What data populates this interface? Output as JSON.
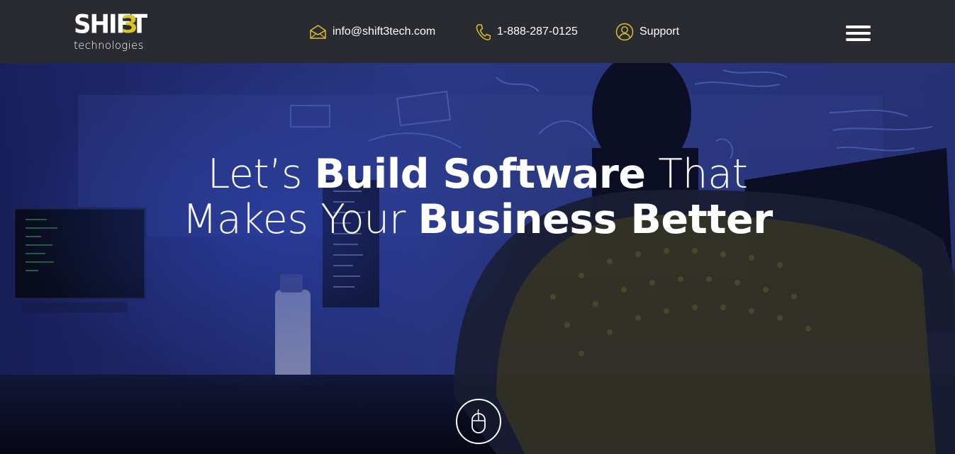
{
  "header": {
    "logo": {
      "word": "SHIFT",
      "number": "3",
      "sub": "technologies"
    },
    "email": {
      "icon": "envelope-icon",
      "label": "info@shift3tech.com"
    },
    "phone": {
      "icon": "phone-icon",
      "label": "1-888-287-0125"
    },
    "support": {
      "icon": "user-circle-icon",
      "label": "Support"
    },
    "menu_icon": "hamburger-menu-icon"
  },
  "hero": {
    "headline": {
      "line1_thin_a": "Let’s ",
      "line1_bold": "Build Software",
      "line1_thin_b": " That",
      "line2_thin": "Makes Your ",
      "line2_bold": "Business Better"
    },
    "scroll_icon": "mouse-scroll-icon"
  },
  "colors": {
    "topbar": "#2a2b30",
    "accent": "#d9c327",
    "hero_dark": "#0a0d24",
    "hero_blue": "#2a3a8c"
  }
}
